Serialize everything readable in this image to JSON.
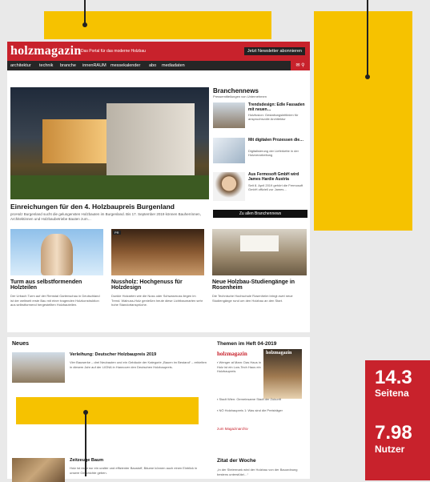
{
  "colors": {
    "brand_red": "#c8222c",
    "ad_yellow": "#f6c200",
    "nav_dark": "#262626"
  },
  "site": {
    "logo": "holzmagazin",
    "tagline": "Das Portal für das moderne Holzbau",
    "newsletter_button": "Jetzt Newsletter abonnieren"
  },
  "nav": {
    "items": [
      "architektur",
      "technik",
      "branche",
      "innenRAUM",
      "messekalender",
      "abo",
      "mediadaten"
    ],
    "icons": [
      "mail-icon",
      "search-icon"
    ]
  },
  "hero": {
    "title": "Einreichungen für den 4. Holzbaupreis Burgenland",
    "text": "proHolz Burgenland sucht die gelungensten Holzbauten im Burgenland. Bis 17. September 2019 können Bauherrinnen, Architektinnen und Holzbaubetriebe Bauten zum…"
  },
  "branchennews": {
    "title": "Branchennews",
    "subtitle": "Pressemitteilungen von Unternehmen",
    "items": [
      {
        "title": "Trendsdesign: Edle Fassaden mit neuen…",
        "text": "Holzfusion: Gestaltungsleitlinien für anspruchsvolle Architektur"
      },
      {
        "title": "Mit digitalen Prozessen die…",
        "text": "Digitalisierung der Lieferkette in der Holzverarbeitung"
      },
      {
        "title": "Aus Fermosoft GmbH wird James Hardie Austria",
        "text": "Seit 8. April 2019 gehört die Fermosoft GmbH offiziell zur James…"
      }
    ],
    "button": "Zu allen Branchennews"
  },
  "articles": [
    {
      "title": "Turm aus selbstformenden Holzteilen",
      "text": "Der Urbach Turm auf der Remstal Gartenschau in Deutschland ist der weltweit erste Bau mit einer tragenden Holzkonstruktion aus selbstformend hergestellten Holzbauteilen."
    },
    {
      "title": "Nussholz: Hochgenuss für Holzdesign",
      "text": "Dunkle Holzarten wie die Nuss oder Schwarznuss liegen im Trend. Walnuss-Holz genießen heute diese Lichtbaumarten sehr hohe Standortansprüche.",
      "badge": "PR"
    },
    {
      "title": "Neue Holzbau-Studiengänge in Rosenheim",
      "text": "Die Technische Hochschule Rosenheim bringt zwei neue Studiengänge rund um den Holzbau an den Start."
    }
  ],
  "neues": {
    "title": "Neues",
    "items": [
      {
        "title": "Verleihung: Deutscher Holzbaupreis 2019",
        "text": "Vier Bauwerke – drei Neubauten und ein Gebäude der Kategorie „Bauen im Bestand“ – erhielten in diesem Jahr auf der LIGNA in Hannover den Deutschen Holzbaupreis."
      },
      {
        "title": "Zeitzeuge Baum",
        "text": "Holz ist nicht nur ein uralter und effizienter Baustoff, Bäume können auch einen Einblick in unsere Geschichte geben."
      }
    ]
  },
  "themen": {
    "title": "Themen im Heft 04-2019",
    "logo": "holzmagazin",
    "cover_logo": "holzmagazin",
    "bullets": [
      "Wenger at Mam: Das Haus in Holz ist ein Low-Tech Haus ein Holzbaupreis",
      "Stadt Wien: Gemeinsame Stadt der Zukunft",
      "NÖ Holzbaupreis 1: Was sind die Preisträger"
    ],
    "link": "zum Magazinarchiv"
  },
  "zitat": {
    "title": "Zitat der Woche",
    "text": "„In der Steiermark wird der Holzbau von der Bauordnung bestens unterstützt…“"
  },
  "stats": {
    "value1": "14.3",
    "label1": "Seitena",
    "value2": "7.98",
    "label2": "Nutzer"
  }
}
